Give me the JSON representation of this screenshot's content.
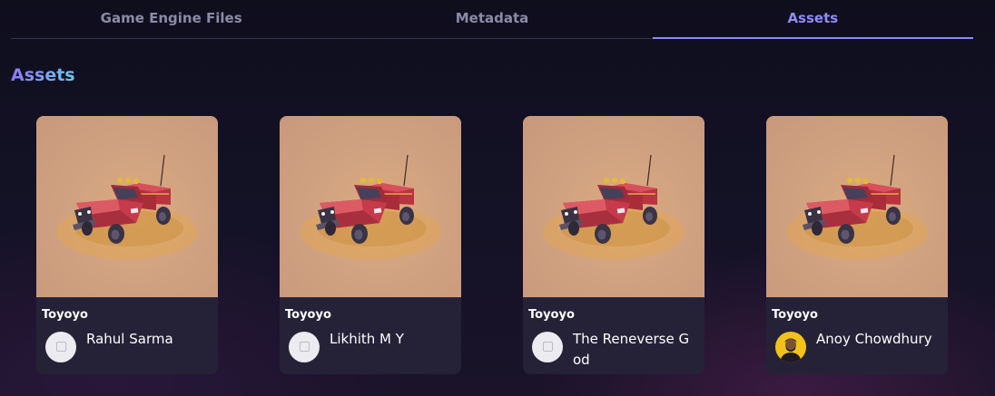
{
  "tabs": [
    {
      "label": "Game Engine Files",
      "active": false
    },
    {
      "label": "Metadata",
      "active": false
    },
    {
      "label": "Assets",
      "active": true
    }
  ],
  "section_title": "Assets",
  "assets": [
    {
      "name": "Toyoyo",
      "creator": "Rahul Sarma",
      "avatar": "placeholder-avatar-icon"
    },
    {
      "name": "Toyoyo",
      "creator": "Likhith M Y",
      "avatar": "placeholder-avatar-icon"
    },
    {
      "name": "Toyoyo",
      "creator": "The Reneverse God",
      "avatar": "placeholder-avatar-icon"
    },
    {
      "name": "Toyoyo",
      "creator": "Anoy Chowdhury",
      "avatar": "profile-photo"
    }
  ],
  "colors": {
    "accent": "#8d8cf8",
    "tab_inactive": "#8c8aa6",
    "card_bg": "#252238",
    "thumb_bg": "#cfa080",
    "truck_red": "#c63a4c",
    "avatar_yellow": "#f2c21a"
  }
}
